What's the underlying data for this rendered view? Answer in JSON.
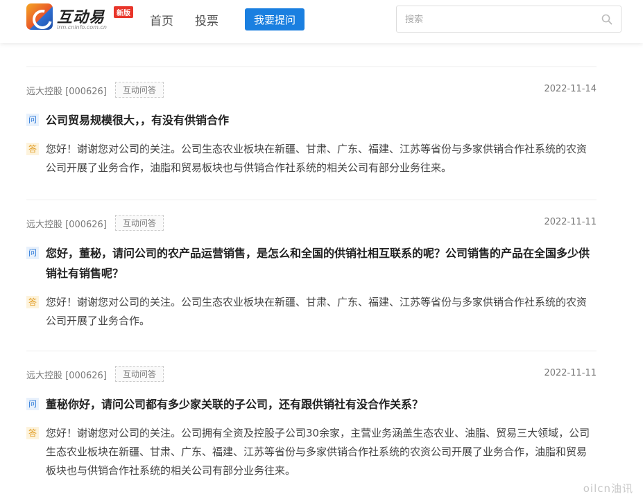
{
  "header": {
    "logo_title": "互动易",
    "logo_badge": "新版",
    "logo_sub": "irm.cninfo.com.cn",
    "nav": [
      "首页",
      "投票"
    ],
    "ask_button": "我要提问",
    "search_placeholder": "搜索",
    "search_icon": "search-icon"
  },
  "items": [
    {
      "company": "远大控股 [000626]",
      "tag": "互动问答",
      "date": "2022-11-14",
      "q_mark": "问",
      "question": "公司贸易规模很大，，有没有供销合作",
      "a_mark": "答",
      "answer": "您好！谢谢您对公司的关注。公司生态农业板块在新疆、甘肃、广东、福建、江苏等省份与多家供销合作社系统的农资公司开展了业务合作，油脂和贸易板块也与供销合作社系统的相关公司有部分业务往来。"
    },
    {
      "company": "远大控股 [000626]",
      "tag": "互动问答",
      "date": "2022-11-11",
      "q_mark": "问",
      "question": "您好，董秘，请问公司的农产品运营销售，是怎么和全国的供销社相互联系的呢？公司销售的产品在全国多少供销社有销售呢？",
      "a_mark": "答",
      "answer": "您好！谢谢您对公司的关注。公司生态农业板块在新疆、甘肃、广东、福建、江苏等省份与多家供销合作社系统的农资公司开展了业务合作。"
    },
    {
      "company": "远大控股 [000626]",
      "tag": "互动问答",
      "date": "2022-11-11",
      "q_mark": "问",
      "question": "董秘你好，请问公司都有多少家关联的子公司，还有跟供销社有没合作关系？",
      "a_mark": "答",
      "answer": "您好！谢谢您对公司的关注。公司拥有全资及控股子公司30余家，主营业务涵盖生态农业、油脂、贸易三大领域，公司生态农业板块在新疆、甘肃、广东、福建、江苏等省份与多家供销合作社系统的农资公司开展了业务合作，油脂和贸易板块也与供销合作社系统的相关公司有部分业务往来。"
    }
  ],
  "watermark": "oilcn油讯",
  "colors": {
    "primary": "#1a7fe0",
    "badge": "#e8352a"
  }
}
